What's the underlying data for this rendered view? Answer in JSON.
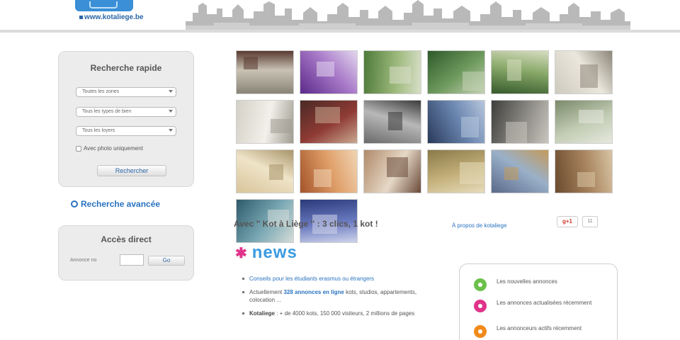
{
  "header": {
    "logo_url": "www.kotaliege.be"
  },
  "quick_search": {
    "title": "Recherche rapide",
    "select_zones": "Toutes les zones",
    "select_type": "Tous les types de bien",
    "select_loyers": "Tous les loyers",
    "checkbox_label": "Avec photo uniquement",
    "search_button": "Rechercher"
  },
  "advanced_search": {
    "label": "Recherche avancée"
  },
  "direct_access": {
    "title": "Accès direct",
    "label": "Annonce no",
    "go_button": "Go"
  },
  "photos": [
    {
      "name": "photo-bedroom-1",
      "colors": [
        "#8a8478",
        "#c9c2b4",
        "#5a3a32"
      ]
    },
    {
      "name": "photo-purple-room",
      "colors": [
        "#5b2a8a",
        "#a879c8",
        "#e2d6ee"
      ]
    },
    {
      "name": "photo-garden",
      "colors": [
        "#4e7a3a",
        "#9bb87a",
        "#d8dfc8"
      ]
    },
    {
      "name": "photo-building-trees",
      "colors": [
        "#2e5a2a",
        "#6f9a5e",
        "#c4d2b4"
      ]
    },
    {
      "name": "photo-park-path",
      "colors": [
        "#355a2c",
        "#8aaa6a",
        "#d6dcc0"
      ]
    },
    {
      "name": "photo-white-room",
      "colors": [
        "#cfcabe",
        "#ebe7dd",
        "#8c8678"
      ]
    },
    {
      "name": "photo-kitchen-white",
      "colors": [
        "#d4d0c6",
        "#f2f0ea",
        "#a09c92"
      ]
    },
    {
      "name": "photo-red-bedroom",
      "colors": [
        "#4a2a26",
        "#8e3a34",
        "#c9a890"
      ]
    },
    {
      "name": "photo-grey-room",
      "colors": [
        "#6a6a6a",
        "#b8b8b8",
        "#3a3a3a"
      ]
    },
    {
      "name": "photo-bridge-river",
      "colors": [
        "#2a3a5a",
        "#6a86b0",
        "#b7c6dc"
      ]
    },
    {
      "name": "photo-dark-kitchen",
      "colors": [
        "#3e3e3c",
        "#8c8a84",
        "#c8c6be"
      ]
    },
    {
      "name": "photo-green-room",
      "colors": [
        "#7a8a6a",
        "#c2ccb4",
        "#e6e8de"
      ]
    },
    {
      "name": "photo-bright-room",
      "colors": [
        "#d8c49a",
        "#efe4c8",
        "#a8946a"
      ]
    },
    {
      "name": "photo-lamp-room",
      "colors": [
        "#a4542a",
        "#e0a06a",
        "#f0d4b4"
      ]
    },
    {
      "name": "photo-living-room",
      "colors": [
        "#b08a6a",
        "#e6d8c6",
        "#6a4a3a"
      ]
    },
    {
      "name": "photo-facade",
      "colors": [
        "#8a7a4a",
        "#c4b07a",
        "#e6dcbc"
      ]
    },
    {
      "name": "photo-city-view",
      "colors": [
        "#5a6a8a",
        "#9ab0c8",
        "#c49a5a"
      ]
    },
    {
      "name": "photo-brown-kitchen",
      "colors": [
        "#6a4a2e",
        "#a8845e",
        "#d8c4a4"
      ]
    },
    {
      "name": "photo-blue-sofa",
      "colors": [
        "#2e5a6a",
        "#7aa8b4",
        "#d6dcd8"
      ]
    },
    {
      "name": "photo-blue-window",
      "colors": [
        "#2a3a7a",
        "#6a7ac0",
        "#cfd4ea"
      ]
    }
  ],
  "tagline": {
    "text": "Avec \" Kot à Liège \" : 3 clics, 1 kot !",
    "about_link": "À propos de kotaliege",
    "gplus_label": "g+1",
    "gplus_count": "11"
  },
  "news": {
    "heading": "news",
    "items": [
      {
        "link": "Conseils pour les étudiants erasmus ou étrangers"
      },
      {
        "prefix": "Actuellement ",
        "strong_link": "328 annonces en ligne",
        "suffix": " kots, studios, appartements, colocation ..."
      },
      {
        "bold": "Kotaliege",
        "text": " : + de 4000 kots, 150 000 visiteurs, 2 millions de pages"
      }
    ]
  },
  "legend": {
    "items": [
      {
        "text": "Les nouvelles annonces",
        "color": "#6cc04a"
      },
      {
        "text": "Les annonces actualisées récemment",
        "color": "#e0338a"
      },
      {
        "text": "Les annonceurs actifs récemment",
        "color": "#f08a1a"
      }
    ]
  }
}
